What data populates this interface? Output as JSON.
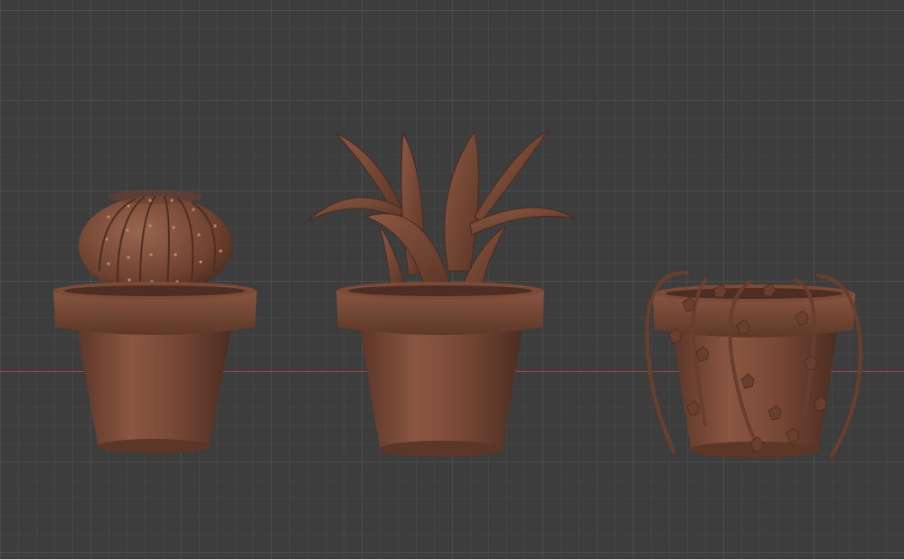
{
  "viewport": {
    "background_color": "#3d3d3d",
    "grid_color": "#474747",
    "x_axis_color": "#b3444f"
  },
  "scene": {
    "material_color": "#7a4a37",
    "objects": [
      {
        "id": "cactus-pot",
        "icon": "barrel-cactus-model"
      },
      {
        "id": "agave-pot",
        "icon": "agave-plant-model"
      },
      {
        "id": "ivy-pot",
        "icon": "hanging-ivy-model"
      }
    ]
  }
}
